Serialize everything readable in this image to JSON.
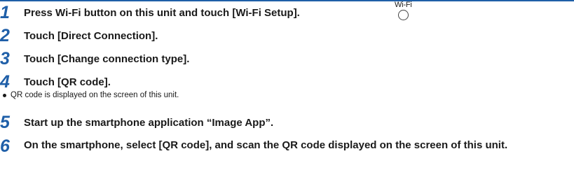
{
  "steps": [
    {
      "number": "1",
      "text": "Press Wi-Fi button on this unit and touch [Wi-Fi Setup]."
    },
    {
      "number": "2",
      "text": "Touch [Direct Connection]."
    },
    {
      "number": "3",
      "text": "Touch [Change connection type]."
    },
    {
      "number": "4",
      "text": "Touch [QR code]."
    },
    {
      "number": "5",
      "text": "Start up the smartphone application “Image App”."
    },
    {
      "number": "6",
      "text": "On the smartphone, select [QR code], and scan the QR code displayed on the screen of this unit."
    }
  ],
  "note": "QR code is displayed on the screen of this unit.",
  "wifi_button": {
    "label": "Wi-Fi",
    "icon": "round-button-icon"
  },
  "colors": {
    "step_number": "#1f5fa8",
    "rule": "#1f5fa8"
  }
}
